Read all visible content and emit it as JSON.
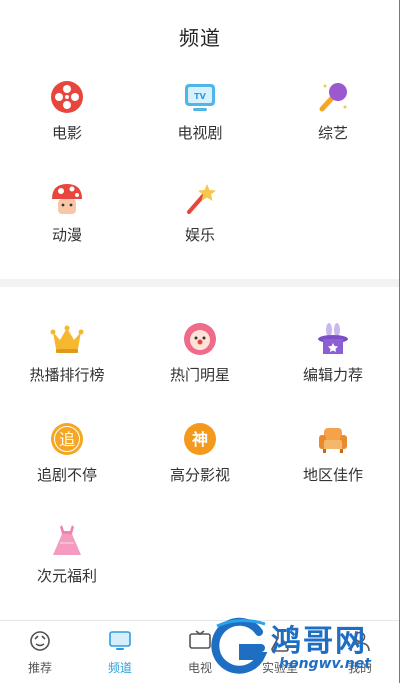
{
  "header": {
    "title": "频道"
  },
  "channels": [
    {
      "label": "电影",
      "icon": "film-reel-icon"
    },
    {
      "label": "电视剧",
      "icon": "tv-icon"
    },
    {
      "label": "综艺",
      "icon": "microphone-icon"
    },
    {
      "label": "动漫",
      "icon": "mushroom-icon"
    },
    {
      "label": "娱乐",
      "icon": "magic-wand-icon"
    }
  ],
  "features": [
    {
      "label": "热播排行榜",
      "icon": "crown-icon"
    },
    {
      "label": "热门明星",
      "icon": "clown-face-icon"
    },
    {
      "label": "编辑力荐",
      "icon": "magic-hat-icon"
    },
    {
      "label": "追剧不停",
      "icon": "zhui-badge-icon",
      "glyph": "追"
    },
    {
      "label": "高分影视",
      "icon": "shen-badge-icon",
      "glyph": "神"
    },
    {
      "label": "地区佳作",
      "icon": "armchair-icon"
    },
    {
      "label": "次元福利",
      "icon": "dress-icon"
    }
  ],
  "tabbar": [
    {
      "label": "推荐",
      "icon": "recommend-icon",
      "active": false
    },
    {
      "label": "频道",
      "icon": "monitor-icon",
      "active": true
    },
    {
      "label": "电视",
      "icon": "tv-live-icon",
      "active": false
    },
    {
      "label": "实验室",
      "icon": "lab-icon",
      "active": false
    },
    {
      "label": "我的",
      "icon": "profile-icon",
      "active": false
    }
  ],
  "watermark": {
    "brand": "鸿哥网",
    "url": "hongwv.net"
  },
  "colors": {
    "accent": "#2a9ee0",
    "red_edge": "#e04a55",
    "watermark": "#1e6fc3"
  }
}
